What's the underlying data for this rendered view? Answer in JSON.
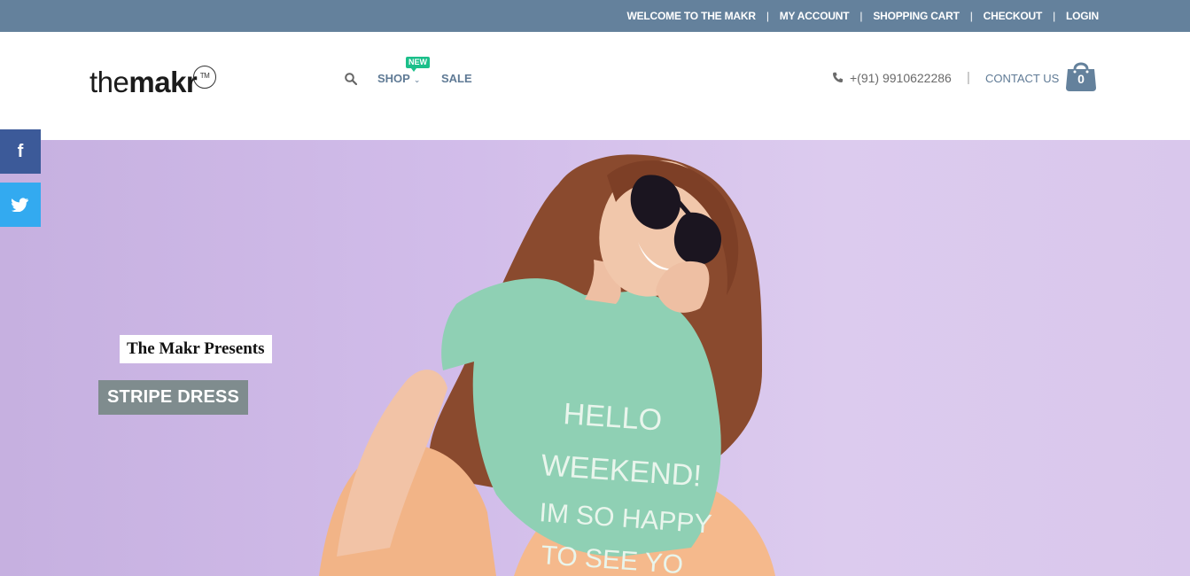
{
  "topbar": {
    "links": [
      "WELCOME TO THE MAKR",
      "MY ACCOUNT",
      "SHOPPING CART",
      "CHECKOUT",
      "LOGIN"
    ],
    "separator": "|"
  },
  "header": {
    "logo": {
      "light": "the",
      "bold": "makr",
      "tm": "TM"
    },
    "nav": {
      "shop": "SHOP",
      "new_badge": "NEW",
      "sale": "SALE"
    },
    "phone": "+(91) 9910622286",
    "separator": "|",
    "contact": "CONTACT US",
    "cart_count": "0"
  },
  "hero": {
    "presents": "The Makr Presents",
    "cta": "STRIPE DRESS",
    "shirt_text": [
      "HELLO",
      "WEEKEND!",
      "IM SO HAPPY",
      "TO SEE YO"
    ]
  },
  "social": {
    "facebook": "f"
  },
  "colors": {
    "topbar": "#64819c",
    "nav": "#5f7a95",
    "badge": "#1bbf8a",
    "facebook": "#3c5a99",
    "twitter": "#33aaf0",
    "hero_bg": "#d2bdea"
  }
}
